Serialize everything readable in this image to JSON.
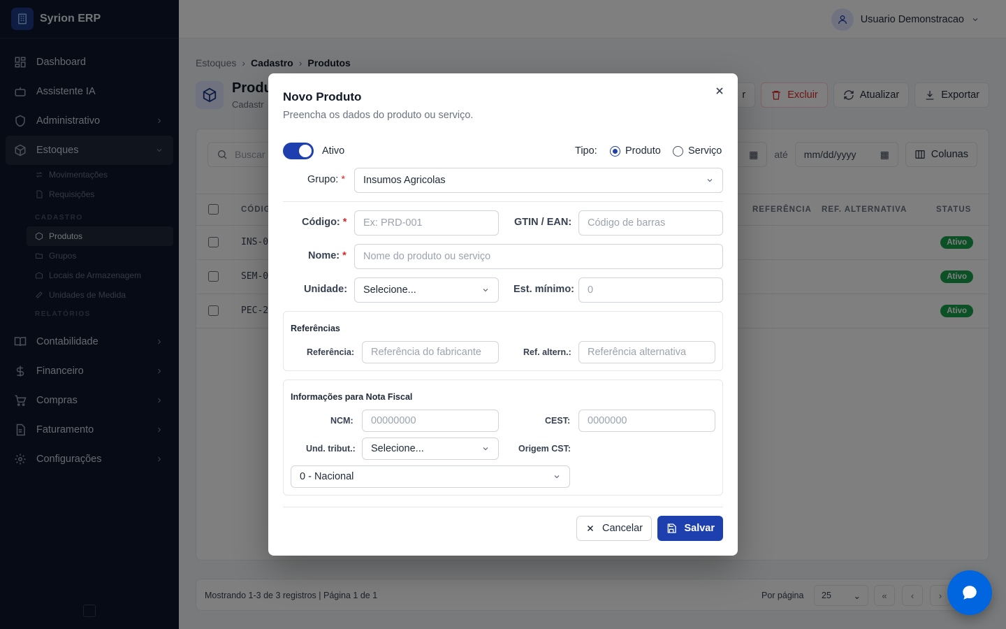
{
  "app": {
    "name": "Syrion ERP"
  },
  "sidebar": {
    "items": [
      {
        "label": "Dashboard",
        "icon": "dashboard-icon"
      },
      {
        "label": "Assistente IA",
        "icon": "bot-icon"
      },
      {
        "label": "Administrativo",
        "icon": "shield-icon"
      },
      {
        "label": "Estoques",
        "icon": "boxes-icon"
      },
      {
        "label": "Contabilidade",
        "icon": "book-icon"
      },
      {
        "label": "Financeiro",
        "icon": "dollar-icon"
      },
      {
        "label": "Compras",
        "icon": "cart-icon"
      },
      {
        "label": "Faturamento",
        "icon": "file-icon"
      },
      {
        "label": "Configurações",
        "icon": "gear-icon"
      }
    ],
    "estoques_sub": {
      "top": [
        "Movimentações",
        "Requisições"
      ],
      "cadastro_header": "CADASTRO",
      "cadastro": [
        "Produtos",
        "Grupos",
        "Locais de Armazenagem",
        "Unidades de Medida"
      ],
      "relatorios_header": "RELATÓRIOS"
    }
  },
  "header": {
    "user_name": "Usuario Demonstracao"
  },
  "breadcrumb": [
    "Estoques",
    "Cadastro",
    "Produtos"
  ],
  "page": {
    "title": "Produ",
    "subtitle": "Cadastr"
  },
  "toolbar": {
    "edit_label": "r",
    "delete_label": "Excluir",
    "refresh_label": "Atualizar",
    "export_label": "Exportar"
  },
  "filters": {
    "search_placeholder": "Buscar",
    "date_from": "",
    "date_sep": "até",
    "date_to": "mm/dd/yyyy",
    "columns_label": "Colunas"
  },
  "table": {
    "headers": {
      "codigo": "CÓDIG",
      "referencia": "REFERÊNCIA",
      "ref_alt": "REF. ALTERNATIVA",
      "status": "STATUS"
    },
    "rows": [
      {
        "code": "INS-0",
        "status": "Ativo"
      },
      {
        "code": "SEM-0",
        "status": "Ativo"
      },
      {
        "code": "PEC-2",
        "status": "Ativo"
      }
    ]
  },
  "pagination": {
    "info": "Mostrando 1-3 de 3 registros | Página 1 de 1",
    "per_page_label": "Por página",
    "per_page": "25"
  },
  "modal": {
    "title": "Novo Produto",
    "description": "Preencha os dados do produto ou serviço.",
    "ativo_label": "Ativo",
    "ativo": true,
    "tipo_label": "Tipo:",
    "tipo_options": [
      "Produto",
      "Serviço"
    ],
    "tipo_selected": "Produto",
    "grupo_label": "Grupo:",
    "grupo_value": "Insumos Agricolas",
    "codigo_label": "Código:",
    "codigo_placeholder": "Ex: PRD-001",
    "gtin_label": "GTIN / EAN:",
    "gtin_placeholder": "Código de barras",
    "nome_label": "Nome:",
    "nome_placeholder": "Nome do produto ou serviço",
    "unidade_label": "Unidade:",
    "unidade_value": "Selecione...",
    "est_min_label": "Est. mínimo:",
    "est_min_placeholder": "0",
    "referencias": {
      "title": "Referências",
      "ref_label": "Referência:",
      "ref_placeholder": "Referência do fabricante",
      "ref_alt_label": "Ref. altern.:",
      "ref_alt_placeholder": "Referência alternativa"
    },
    "nota_fiscal": {
      "title": "Informações para Nota Fiscal",
      "ncm_label": "NCM:",
      "ncm_placeholder": "00000000",
      "cest_label": "CEST:",
      "cest_placeholder": "0000000",
      "und_trib_label": "Und. tribut.:",
      "und_trib_value": "Selecione...",
      "origem_label": "Origem CST:",
      "origem_value": "0 - Nacional"
    },
    "cancel_label": "Cancelar",
    "save_label": "Salvar"
  },
  "colors": {
    "primary": "#1e40af",
    "sidebar_bg": "#0f172a",
    "success": "#16a34a",
    "danger": "#dc2626",
    "fab": "#0066e0"
  }
}
